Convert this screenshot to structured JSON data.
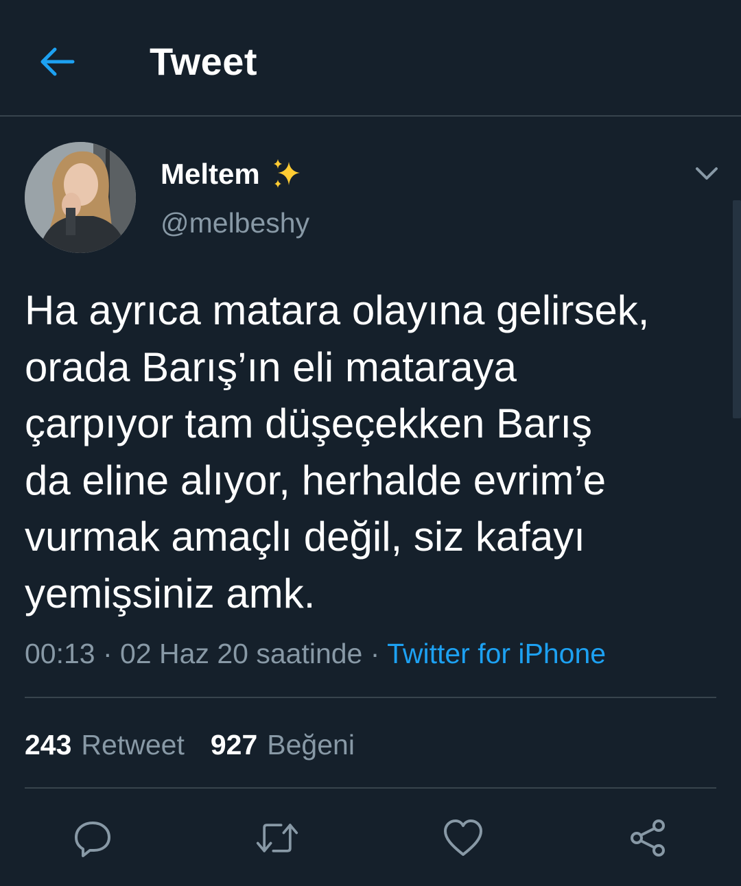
{
  "header": {
    "title": "Tweet",
    "back_icon": "arrow-left-icon"
  },
  "author": {
    "display_name": "Meltem",
    "name_emoji_icon": "sparkles-icon",
    "handle": "@melbeshy",
    "avatar_icon": "profile-photo"
  },
  "tweet": {
    "text": "Ha ayrıca matara olayına gelirsek,\norada Barış’ın eli mataraya\nçarpıyor tam düşeçekken Barış\nda eline alıyor, herhalde evrim’e\nvurmak amaçlı değil, siz kafayı\nyemişsiniz amk.",
    "time": "00:13",
    "sep1": " · ",
    "date": "02 Haz 20 saatinde",
    "sep2": " · ",
    "source": "Twitter for iPhone"
  },
  "stats": {
    "retweets_count": "243",
    "retweets_label": "Retweet",
    "likes_count": "927",
    "likes_label": "Beğeni"
  },
  "actions": {
    "reply_icon": "reply-icon",
    "retweet_icon": "retweet-icon",
    "like_icon": "heart-icon",
    "share_icon": "share-icon"
  },
  "colors": {
    "background": "#15202b",
    "accent": "#1da1f2",
    "secondary_text": "#8899a6",
    "divider": "#38444d",
    "sparkle": "#ffcc33"
  }
}
